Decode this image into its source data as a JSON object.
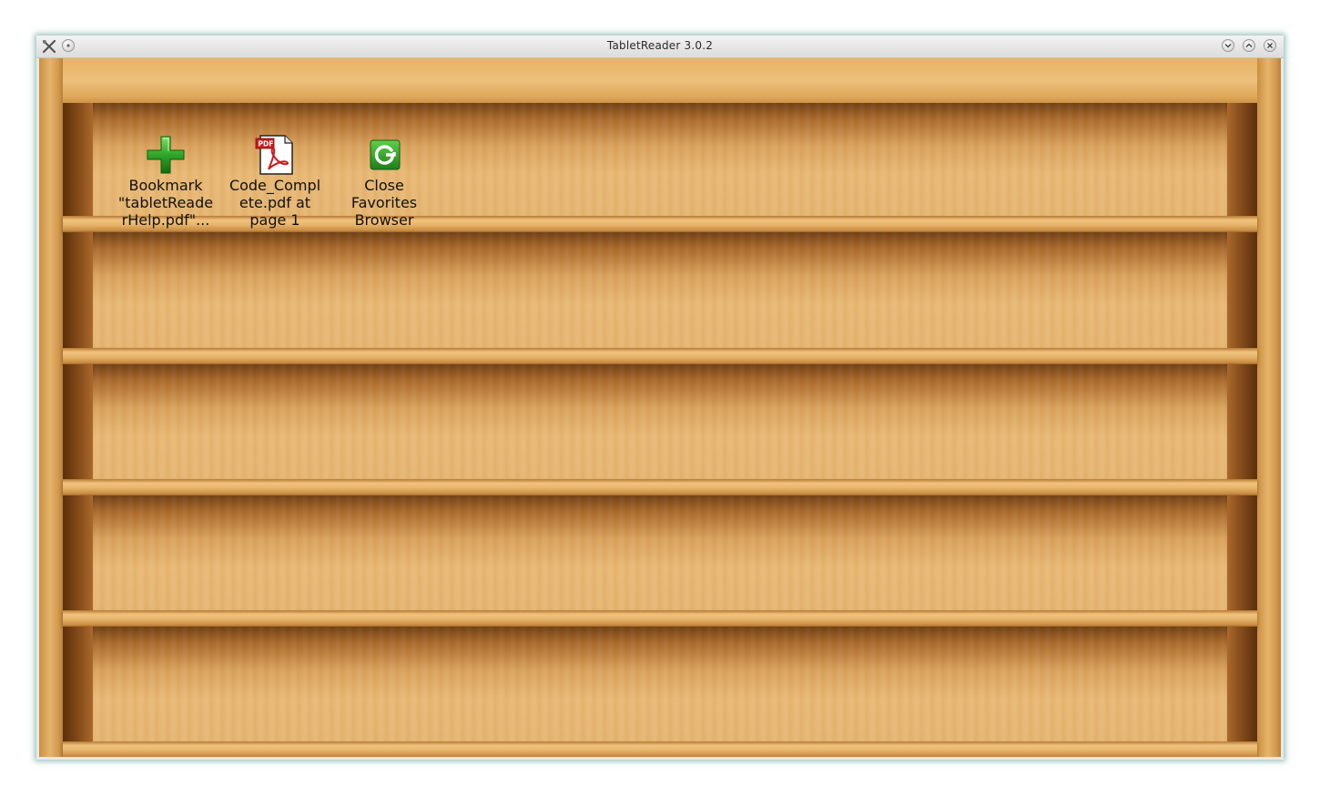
{
  "window": {
    "title": "TabletReader 3.0.2",
    "colors": {
      "titlebar": "#e3e3e3",
      "wood_light": "#e8b874",
      "wood_dark": "#6e3d12"
    }
  },
  "titlebar_buttons": {
    "left": [
      "app-menu-icon",
      "pin-icon"
    ],
    "right": [
      "minimize-icon",
      "maximize-icon",
      "close-icon"
    ]
  },
  "shelf": {
    "rows": 5,
    "items": [
      {
        "icon": "add-bookmark-icon",
        "label": "Bookmark\n\"tabletReade\nrHelp.pdf\"..."
      },
      {
        "icon": "pdf-file-icon",
        "label": "Code_Compl\nete.pdf at\npage 1"
      },
      {
        "icon": "close-browser-icon",
        "label": "Close\nFavorites\nBrowser"
      }
    ]
  }
}
